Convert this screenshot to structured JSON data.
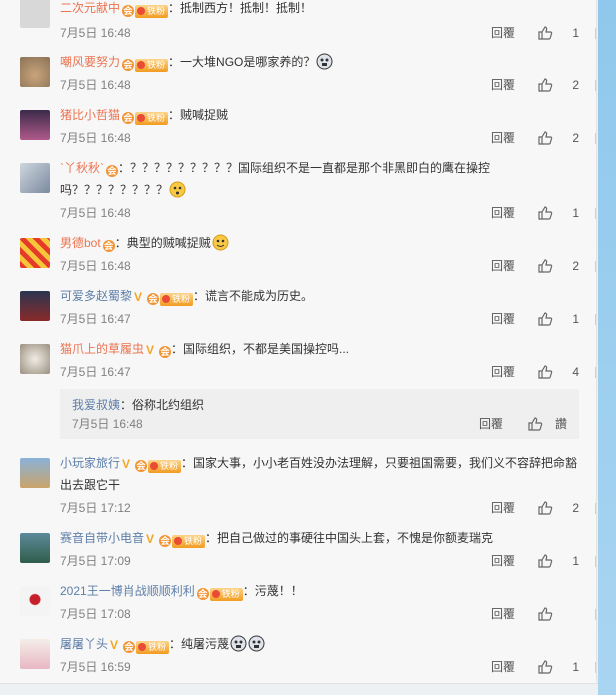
{
  "colors": {
    "user_orange": "#eb7350",
    "user_blue": "#5d7ea8",
    "meta_gray": "#808080"
  },
  "comments": [
    {
      "user": "二次元献中",
      "text": "：抵制西方！抵制！抵制！",
      "time": "7月5日 16:48",
      "reply": "回覆",
      "likes": "1"
    },
    {
      "user": "嘲风要努力",
      "text": "：一大堆NGO是哪家养的？",
      "time": "7月5日 16:48",
      "reply": "回覆",
      "likes": "2"
    },
    {
      "user": "猪比小哲猫",
      "text": "：贼喊捉贼",
      "time": "7月5日 16:48",
      "reply": "回覆",
      "likes": "2"
    },
    {
      "user": "`丫秋秋`",
      "text": "：？？？？？？？？？国际组织不是一直都是那个非黑即白的鹰在操控",
      "text2": "吗？？？？？？？？",
      "time": "7月5日 16:48",
      "reply": "回覆",
      "likes": "1"
    },
    {
      "user": "男德bot",
      "text": "：典型的贼喊捉贼",
      "time": "7月5日 16:48",
      "reply": "回覆",
      "likes": "2"
    },
    {
      "user": "可爱多赵蜀黎",
      "text": "：谎言不能成为历史。",
      "time": "7月5日 16:47",
      "reply": "回覆",
      "likes": "1"
    },
    {
      "user": "猫爪上的草履虫",
      "text": "：国际组织，不都是美国操控吗...",
      "time": "7月5日 16:47",
      "reply": "回覆",
      "likes": "4"
    },
    {
      "user": "小玩家旅行",
      "text": "：国家大事，小小老百姓没办法理解，只要祖国需要，我们义不容辞把命豁",
      "text2": "出去跟它干",
      "time": "7月5日 17:12",
      "reply": "回覆",
      "likes": "2"
    },
    {
      "user": "赛音自带小电音",
      "text": "：把自己做过的事硬往中国头上套，不愧是你额麦瑞克",
      "time": "7月5日 17:09",
      "reply": "回覆",
      "likes": "1"
    },
    {
      "user": "2021王一博肖战顺顺利利",
      "text": "：污蔑！！",
      "time": "7月5日 17:08",
      "reply": "回覆",
      "likes": ""
    },
    {
      "user": "屠屠丫头",
      "text": "：纯屠污蔑",
      "time": "7月5日 16:59",
      "reply": "回覆",
      "likes": "1"
    }
  ],
  "subreply": {
    "user": "我爱叔姨",
    "text": "：俗称北约组织",
    "time": "7月5日 16:48",
    "reply": "回覆",
    "likes": "讚"
  },
  "badges": {
    "fan": "铁粉",
    "vip": "V"
  },
  "icons": {
    "like": "thumbs-up-icon",
    "emoji": "emoji-face-icon"
  }
}
